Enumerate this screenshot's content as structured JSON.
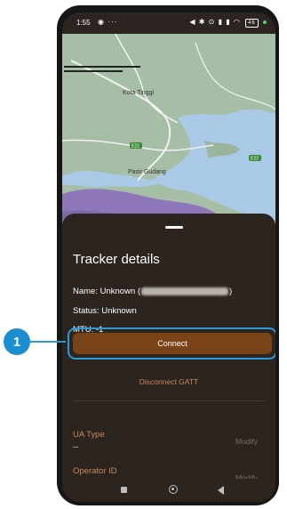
{
  "status_bar": {
    "time": "1:55",
    "left_icons": "◉ ···",
    "right_icons": "◀ ✱ ⊙ ▮ ▮ ◠",
    "battery": "46"
  },
  "map": {
    "place_labels": [
      "Kota Tinggi",
      "Pasir Gudang"
    ],
    "road_labels": [
      "E22",
      "E22"
    ],
    "colors": {
      "land": "#9bb59c",
      "water": "#a9c9e6",
      "roads": "#f2f2f2",
      "purple": "#8e77b8"
    }
  },
  "sheet": {
    "title": "Tracker details",
    "name_prefix": "Name: Unknown (",
    "name_suffix": ")",
    "status": "Status: Unknown",
    "mtu": "MTU: -1",
    "connect_label": "Connect",
    "disconnect_label": "Disconnect GATT",
    "fields": [
      {
        "label": "UA Type",
        "value": "--",
        "action": "Modify"
      },
      {
        "label": "Operator ID",
        "value": "--",
        "action": "Modify"
      }
    ]
  },
  "callout": {
    "number": "1",
    "color": "#1a8ed0"
  }
}
